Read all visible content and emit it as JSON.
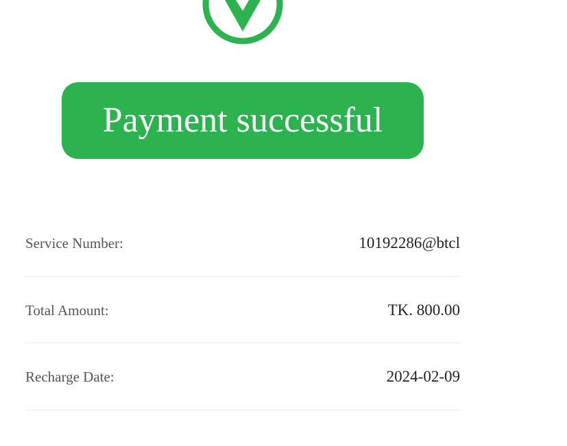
{
  "status": {
    "icon": "check-circle-icon",
    "message": "Payment successful",
    "accent_color": "#2cb34f"
  },
  "details": [
    {
      "label": "Service Number:",
      "value": "10192286@btcl"
    },
    {
      "label": "Total Amount:",
      "value": "TK. 800.00"
    },
    {
      "label": "Recharge Date:",
      "value": "2024-02-09"
    }
  ]
}
